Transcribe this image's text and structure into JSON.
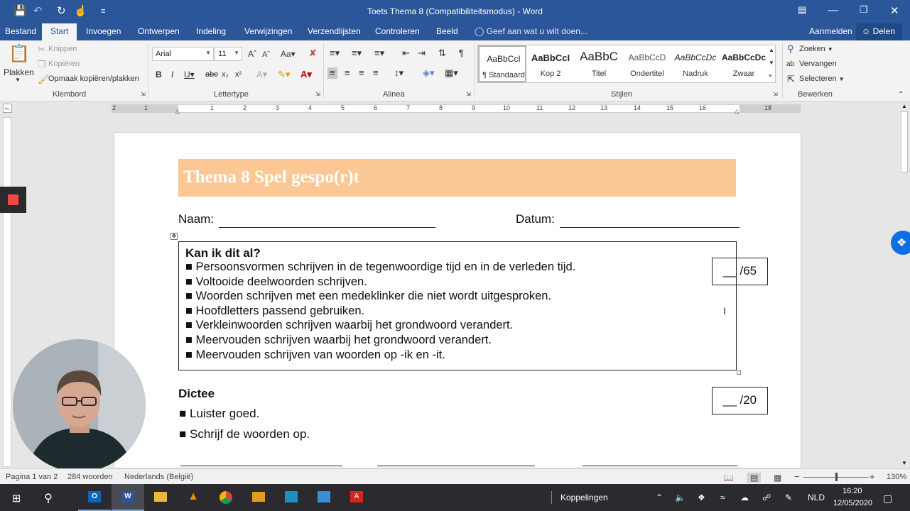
{
  "window": {
    "title": "Toets Thema 8 (Compatibiliteitsmodus) - Word",
    "qa_icons": [
      "save-icon",
      "undo-icon",
      "redo-icon",
      "touch-mode-icon",
      "customize-icon"
    ]
  },
  "tabs": {
    "items": [
      "Bestand",
      "Start",
      "Invoegen",
      "Ontwerpen",
      "Indeling",
      "Verwijzingen",
      "Verzendlijsten",
      "Controleren",
      "Beeld"
    ],
    "active": "Start",
    "tell_me": "Geef aan wat u wilt doen...",
    "sign_in": "Aanmelden",
    "share": "Delen"
  },
  "ribbon": {
    "clipboard": {
      "label": "Klembord",
      "paste": "Plakken",
      "cut": "Knippen",
      "copy": "Kopiëren",
      "format_painter": "Opmaak kopiëren/plakken"
    },
    "font": {
      "label": "Lettertype",
      "name": "Arial",
      "size": "11"
    },
    "paragraph": {
      "label": "Alinea"
    },
    "styles": {
      "label": "Stijlen",
      "items": [
        {
          "sample": "AaBbCcI",
          "name": "¶ Standaard"
        },
        {
          "sample": "AaBbCcI",
          "name": "Kop 2"
        },
        {
          "sample": "AaBbC",
          "name": "Titel"
        },
        {
          "sample": "AaBbCcD",
          "name": "Ondertitel"
        },
        {
          "sample": "AaBbCcDc",
          "name": "Nadruk"
        },
        {
          "sample": "AaBbCcDc",
          "name": "Zwaar"
        }
      ]
    },
    "editing": {
      "label": "Bewerken",
      "find": "Zoeken",
      "replace": "Vervangen",
      "select": "Selecteren"
    }
  },
  "ruler": {
    "numbers": [
      "2",
      "1",
      "1",
      "2",
      "3",
      "4",
      "5",
      "6",
      "7",
      "8",
      "9",
      "10",
      "11",
      "12",
      "13",
      "14",
      "15",
      "16",
      "18"
    ]
  },
  "document": {
    "banner_title": "Thema 8 Spel gespo(r)t",
    "name_label": "Naam:",
    "date_label": "Datum:",
    "checklist_title": "Kan ik dit al?",
    "checklist": [
      "■ Persoonsvormen schrijven in de tegenwoordige tijd en in de verleden tijd.",
      "■ Voltooide deelwoorden schrijven.",
      "■ Woorden schrijven met een medeklinker die niet wordt uitgesproken.",
      "■ Hoofdletters passend gebruiken.",
      "■ Verkleinwoorden schrijven waarbij het grondwoord verandert.",
      "■ Meervouden schrijven waarbij het grondwoord verandert.",
      "■ Meervouden schrijven van woorden op -ik en -it."
    ],
    "score_total": "__ /65",
    "dictee_title": "Dictee",
    "dictee_items": [
      "■ Luister goed.",
      "■ Schrijf de woorden op."
    ],
    "score_dictee": "__ /20"
  },
  "status": {
    "page": "Pagina 1 van 2",
    "words": "284 woorden",
    "language": "Nederlands (België)",
    "zoom": "130%"
  },
  "taskbar": {
    "links_label": "Koppelingen",
    "ime": "NLD",
    "time": "16:20",
    "date": "12/05/2020"
  },
  "colors": {
    "title_blue": "#2b579a",
    "banner": "#fbc794",
    "record": "#f04848"
  }
}
